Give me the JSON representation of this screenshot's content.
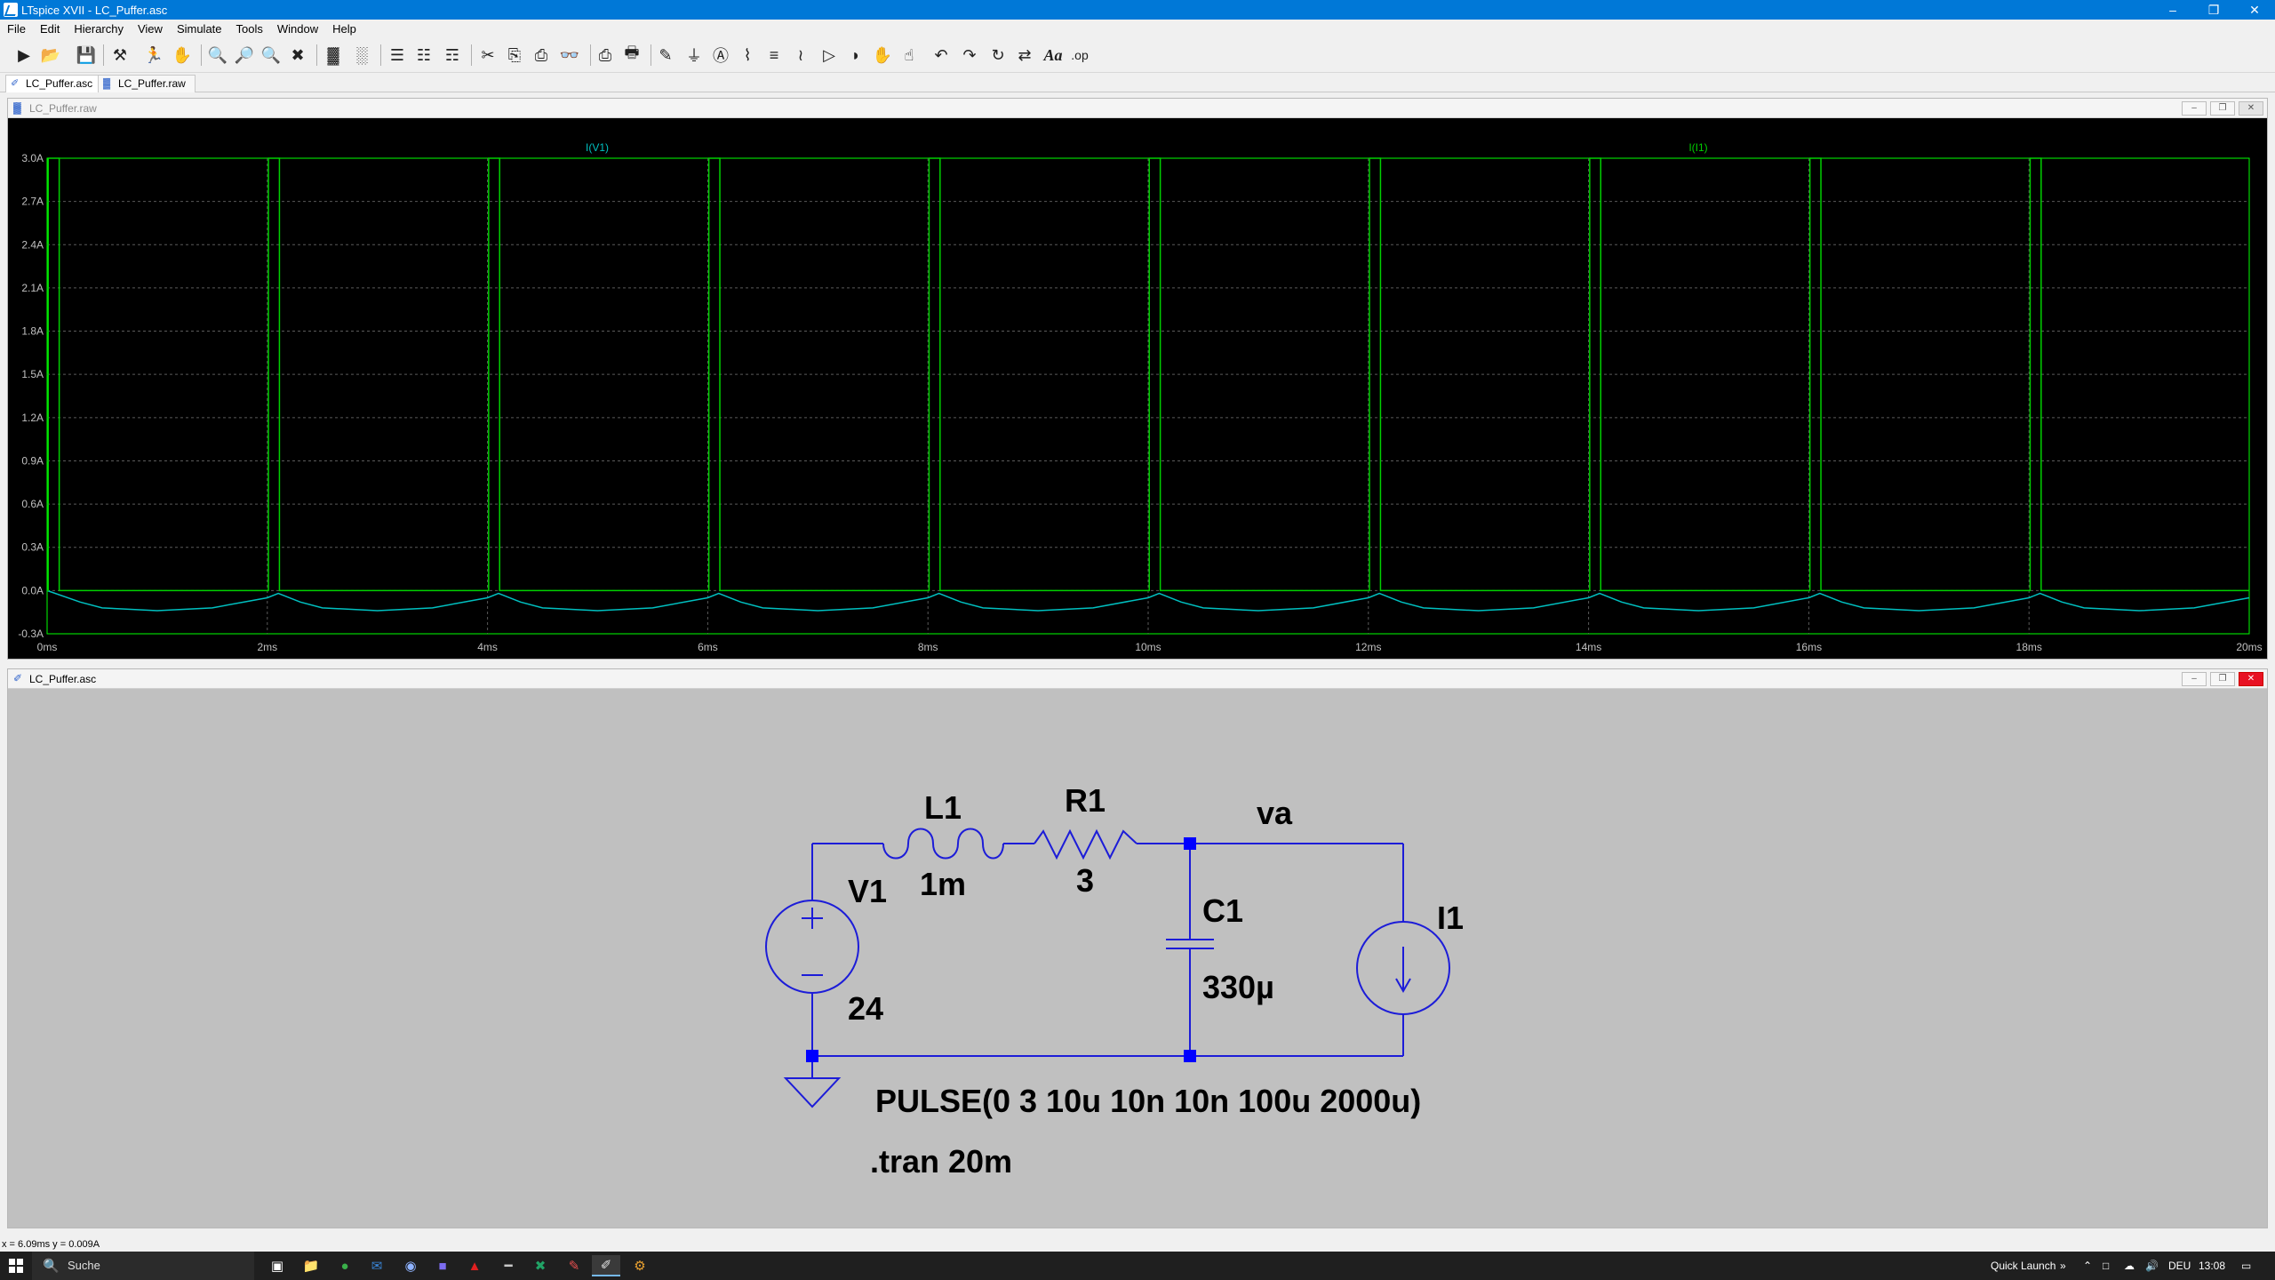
{
  "window": {
    "title": "LTspice XVII - LC_Puffer.asc"
  },
  "menu": [
    "File",
    "Edit",
    "Hierarchy",
    "View",
    "Simulate",
    "Tools",
    "Window",
    "Help"
  ],
  "tabs": [
    {
      "label": "LC_Puffer.asc",
      "active": true
    },
    {
      "label": "LC_Puffer.raw",
      "active": false
    }
  ],
  "waveform_window": {
    "title": "LC_Puffer.raw"
  },
  "schematic_window": {
    "title": "LC_Puffer.asc"
  },
  "chart_data": {
    "type": "line",
    "title": "",
    "xlabel": "",
    "ylabel": "",
    "x_ticks": [
      "0ms",
      "2ms",
      "4ms",
      "6ms",
      "8ms",
      "10ms",
      "12ms",
      "14ms",
      "16ms",
      "18ms",
      "20ms"
    ],
    "y_ticks": [
      "3.0A",
      "2.7A",
      "2.4A",
      "2.1A",
      "1.8A",
      "1.5A",
      "1.2A",
      "0.9A",
      "0.6A",
      "0.3A",
      "0.0A",
      "-0.3A"
    ],
    "xlim": [
      0,
      20
    ],
    "ylim": [
      -0.3,
      3.0
    ],
    "grid": true,
    "x_unit": "ms",
    "series": [
      {
        "name": "I(V1)",
        "color": "#00c0c0",
        "x": [
          0,
          0.3,
          0.5,
          1.0,
          1.5,
          2.0,
          2.1,
          2.3,
          2.5,
          3.0,
          3.5,
          4.0,
          4.1,
          4.3,
          4.5,
          5.0,
          5.5,
          6.0,
          6.1,
          6.3,
          6.5,
          7.0,
          7.5,
          8.0,
          8.1,
          8.3,
          8.5,
          9.0,
          9.5,
          10.0,
          10.1,
          10.3,
          10.5,
          11.0,
          11.5,
          12.0,
          12.1,
          12.3,
          12.5,
          13.0,
          13.5,
          14.0,
          14.1,
          14.3,
          14.5,
          15.0,
          15.5,
          16.0,
          16.1,
          16.3,
          16.5,
          17.0,
          17.5,
          18.0,
          18.1,
          18.3,
          18.5,
          19.0,
          19.5,
          20.0
        ],
        "values": [
          0.0,
          -0.08,
          -0.12,
          -0.14,
          -0.12,
          -0.05,
          -0.02,
          -0.08,
          -0.12,
          -0.14,
          -0.12,
          -0.05,
          -0.02,
          -0.08,
          -0.12,
          -0.14,
          -0.12,
          -0.05,
          -0.02,
          -0.08,
          -0.12,
          -0.14,
          -0.12,
          -0.05,
          -0.02,
          -0.08,
          -0.12,
          -0.14,
          -0.12,
          -0.05,
          -0.02,
          -0.08,
          -0.12,
          -0.14,
          -0.12,
          -0.05,
          -0.02,
          -0.08,
          -0.12,
          -0.14,
          -0.12,
          -0.05,
          -0.02,
          -0.08,
          -0.12,
          -0.14,
          -0.12,
          -0.05,
          -0.02,
          -0.08,
          -0.12,
          -0.14,
          -0.12,
          -0.05,
          -0.02,
          -0.08,
          -0.12,
          -0.14,
          -0.12,
          -0.05
        ]
      },
      {
        "name": "I(I1)",
        "color": "#00d000",
        "pulse": {
          "low": 0,
          "high": 3,
          "delay_ms": 0.01,
          "width_ms": 0.1,
          "period_ms": 2.0
        }
      }
    ]
  },
  "schematic": {
    "components": {
      "L1": {
        "name": "L1",
        "value": "1m"
      },
      "R1": {
        "name": "R1",
        "value": "3"
      },
      "C1": {
        "name": "C1",
        "value": "330µ"
      },
      "V1": {
        "name": "V1",
        "value": "24"
      },
      "I1": {
        "name": "I1",
        "pulse": "PULSE(0 3 10u 10n 10n 100u 2000u)"
      }
    },
    "net_label": "va",
    "directive": ".tran 20m"
  },
  "status": {
    "text": "x = 6.09ms   y = 0.009A"
  },
  "taskbar": {
    "search_placeholder": "Suche",
    "quick_launch": "Quick Launch",
    "language": "DEU",
    "time": "13:08"
  },
  "colors": {
    "accent": "#0078d7",
    "wire": "#1c1cd8",
    "node": "#0000ff",
    "plot_bg": "#000000",
    "schem_bg": "#c0c0c0"
  }
}
